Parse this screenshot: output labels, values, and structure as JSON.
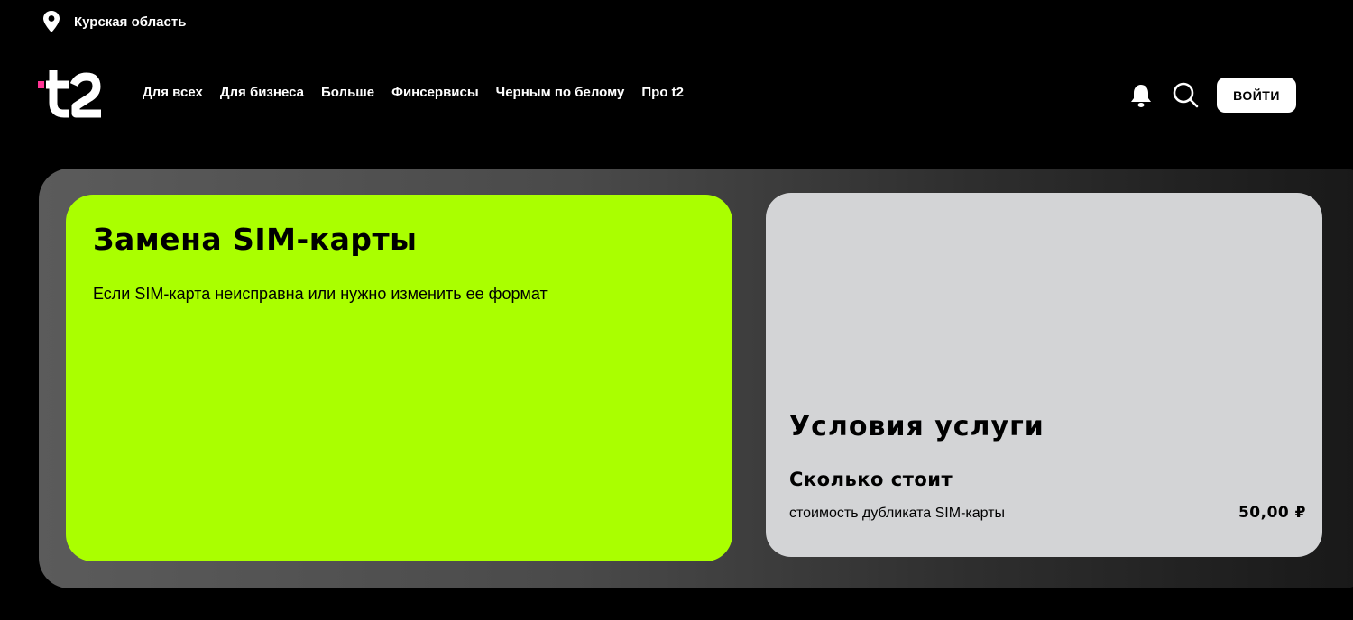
{
  "topbar": {
    "region": "Курская область"
  },
  "header": {
    "logo_text": "t2",
    "nav": [
      {
        "label": "Для всех"
      },
      {
        "label": "Для бизнеса"
      },
      {
        "label": "Больше"
      },
      {
        "label": "Финсервисы"
      },
      {
        "label": "Черным по белому"
      },
      {
        "label": "Про t2"
      }
    ],
    "login_label": "ВОЙТИ"
  },
  "hero": {
    "title": "Замена SIM-карты",
    "subtitle": "Если SIM-карта неисправна или нужно изменить ее формат"
  },
  "conditions": {
    "title": "Условия услуги",
    "cost_heading": "Сколько стоит",
    "item_label": "стоимость дубликата SIM-карты",
    "item_price": "50,00 ₽"
  },
  "icons": {
    "location": "location-pin-icon",
    "notification": "bell-icon",
    "search": "search-icon"
  },
  "colors": {
    "background": "#000000",
    "accent_green": "#aaff00",
    "logo_pink": "#ff3495",
    "card_grey": "#d3d4d6",
    "button_bg": "#ffffff"
  }
}
